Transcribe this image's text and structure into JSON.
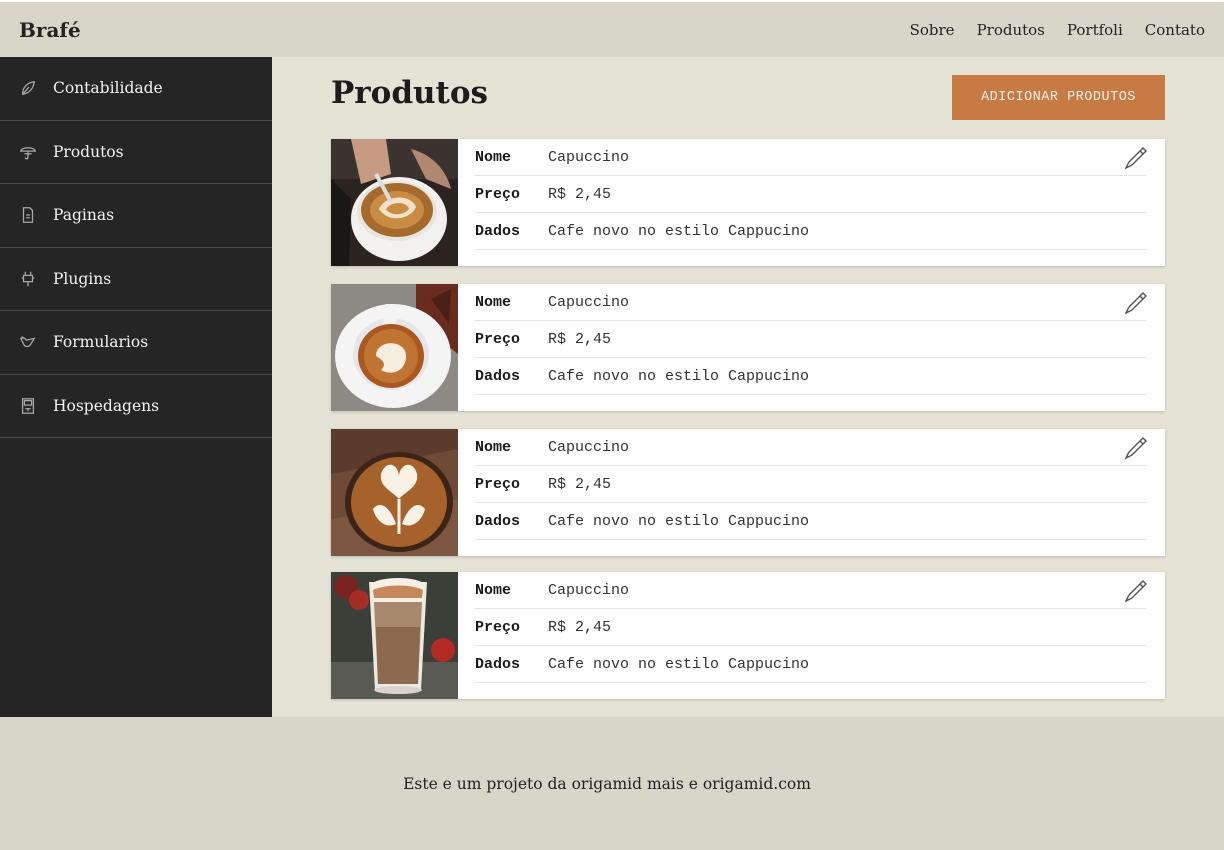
{
  "header": {
    "brand": "Brafé",
    "nav": [
      "Sobre",
      "Produtos",
      "Portfoli",
      "Contato"
    ]
  },
  "sidebar": {
    "items": [
      {
        "label": "Contabilidade",
        "icon": "leaf-icon"
      },
      {
        "label": "Produtos",
        "icon": "umbrella-icon"
      },
      {
        "label": "Paginas",
        "icon": "document-icon"
      },
      {
        "label": "Plugins",
        "icon": "plug-icon"
      },
      {
        "label": "Formularios",
        "icon": "bird-icon"
      },
      {
        "label": "Hospedagens",
        "icon": "server-icon"
      }
    ]
  },
  "main": {
    "title": "Produtos",
    "add_button": "ADICIONAR PRODUTOS",
    "field_labels": {
      "name": "Nome",
      "price": "Preço",
      "data": "Dados"
    },
    "products": [
      {
        "name": "Capuccino",
        "price": "R$ 2,45",
        "data": "Cafe novo no estilo Cappucino"
      },
      {
        "name": "Capuccino",
        "price": "R$ 2,45",
        "data": "Cafe novo no estilo Cappucino"
      },
      {
        "name": "Capuccino",
        "price": "R$ 2,45",
        "data": "Cafe novo no estilo Cappucino"
      },
      {
        "name": "Capuccino",
        "price": "R$ 2,45",
        "data": "Cafe novo no estilo Cappucino"
      }
    ]
  },
  "footer": {
    "text": "Este e um projeto da origamid mais e origamid.com"
  },
  "colors": {
    "accent": "#c87a45",
    "sidebar_bg": "#252525",
    "page_bg": "#e5e2d6",
    "bar_bg": "#d8d5c9"
  }
}
